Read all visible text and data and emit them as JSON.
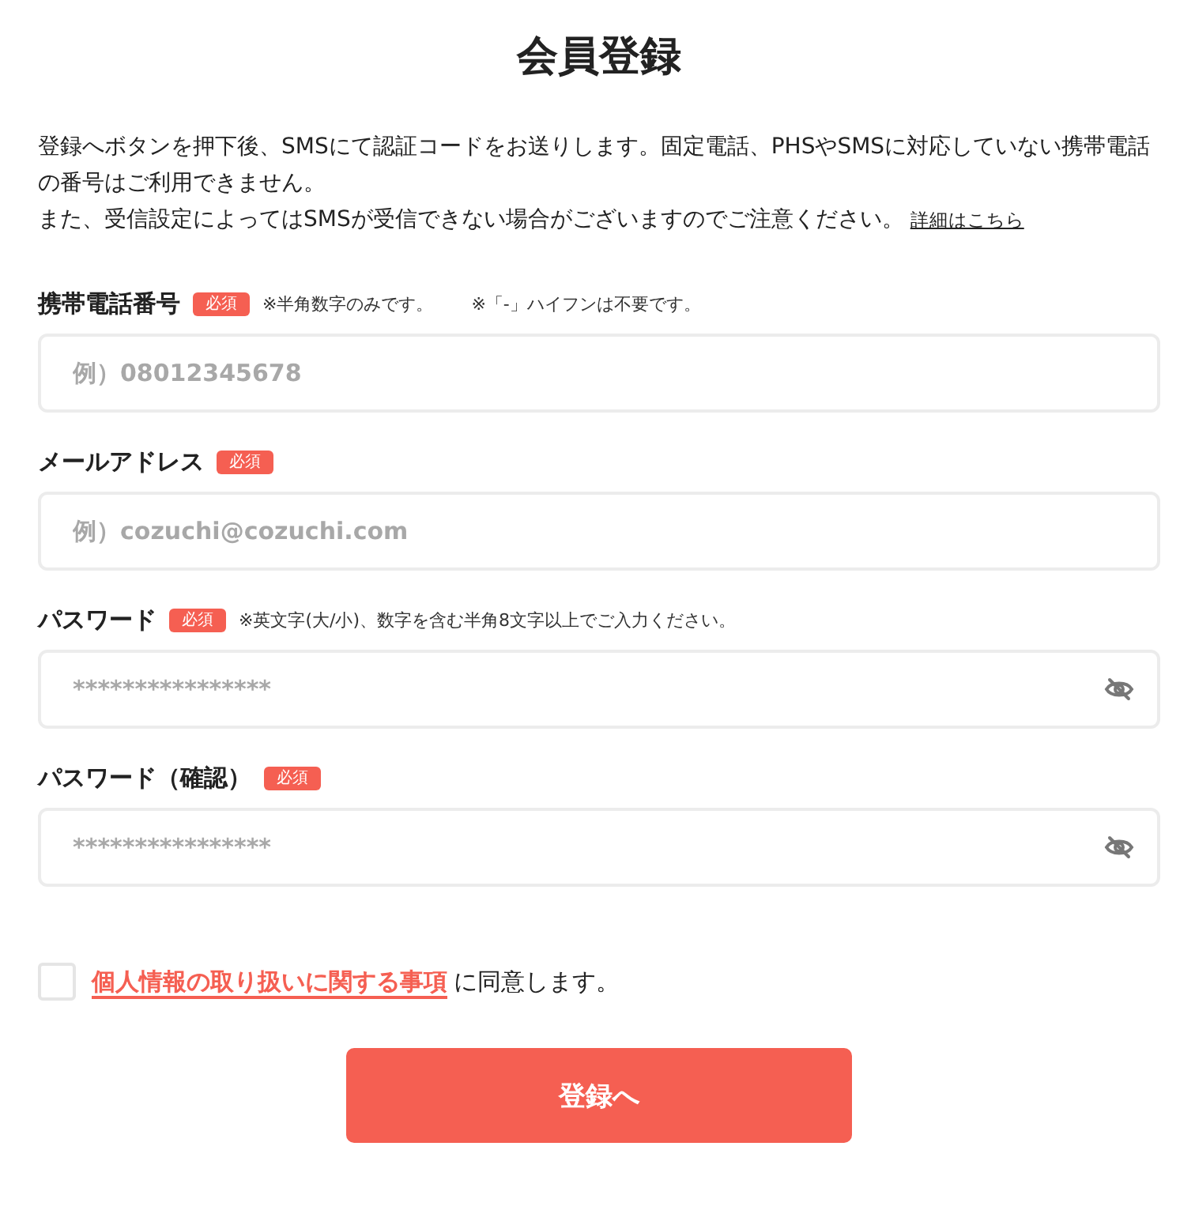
{
  "title": "会員登録",
  "intro": {
    "lines": [
      "登録へボタンを押下後、SMSにて認証コードをお送りします。固定電話、PHSやSMSに対応していない携帯電話の番号はご利用できません。",
      "また、受信設定によってはSMSが受信できない場合がございますのでご注意ください。"
    ],
    "link": "詳細はこちら"
  },
  "fields": [
    {
      "label": "携帯電話番号",
      "badge": "必須",
      "notes": [
        "※半角数字のみです。",
        "※「-」ハイフンは不要です。"
      ],
      "kind": "text",
      "placeholder": "例）08012345678"
    },
    {
      "label": "メールアドレス",
      "badge": "必須",
      "kind": "text",
      "placeholder": "例）cozuchi@cozuchi.com"
    },
    {
      "label": "パスワード",
      "badge": "必須",
      "notes": [
        "※英文字(大/小)、数字を含む半角8文字以上でご入力ください。"
      ],
      "kind": "password",
      "placeholder": "****************"
    },
    {
      "label": "パスワード（確認）",
      "badge": "必須",
      "kind": "password",
      "placeholder": "****************"
    }
  ],
  "consent": {
    "checked": false,
    "link": "個人情報の取り扱いに関する事項",
    "text": "に同意します。"
  },
  "submit": "登録へ"
}
